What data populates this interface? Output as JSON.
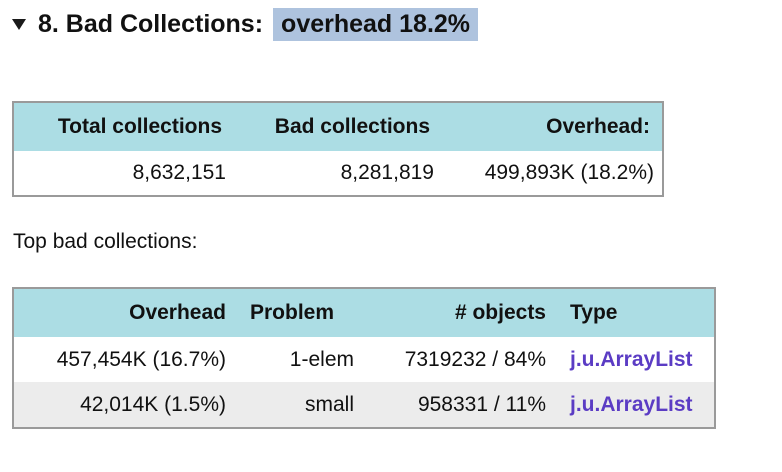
{
  "section": {
    "title": "8. Bad Collections:",
    "overhead": "overhead 18.2%"
  },
  "summary": {
    "headers": [
      "Total collections",
      "Bad collections",
      "Overhead:"
    ],
    "values": [
      "8,632,151",
      "8,281,819",
      "499,893K (18.2%)"
    ]
  },
  "top_label": "Top bad collections:",
  "bad_table": {
    "headers": [
      "Overhead",
      "Problem",
      "# objects",
      "Type"
    ],
    "rows": [
      {
        "overhead": "457,454K (16.7%)",
        "problem": "1-elem",
        "objects": "7319232 / 84%",
        "type": "j.u.ArrayList"
      },
      {
        "overhead": "42,014K (1.5%)",
        "problem": "small",
        "objects": "958331 / 11%",
        "type": "j.u.ArrayList"
      }
    ]
  },
  "colors": {
    "header_bg": "#acdde4",
    "highlight_bg": "#aec3de",
    "link": "#5b3cc4",
    "alt_row": "#ececec",
    "border": "#9a9a9a"
  },
  "icons": {
    "expand": "triangle-down"
  }
}
